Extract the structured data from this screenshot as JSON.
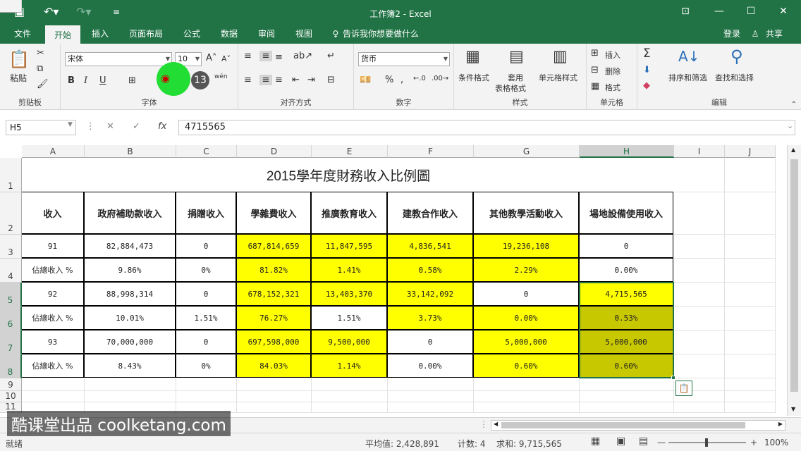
{
  "window": {
    "title": "工作簿2 - Excel"
  },
  "menu_tabs": [
    "文件",
    "开始",
    "插入",
    "页面布局",
    "公式",
    "数据",
    "审阅",
    "视图"
  ],
  "tell_me": "告诉我你想要做什么",
  "account": {
    "login": "登录",
    "share": "共享"
  },
  "ribbon": {
    "clipboard": {
      "label": "剪贴板",
      "paste": "粘贴"
    },
    "font": {
      "label": "字体",
      "name": "宋体",
      "size": "10",
      "bold": "B",
      "italic": "I",
      "underline": "U",
      "phonetic": "wén"
    },
    "alignment": {
      "label": "对齐方式"
    },
    "number": {
      "label": "数字",
      "format": "货币"
    },
    "styles": {
      "label": "样式",
      "cond_format": "条件格式",
      "table_format_1": "套用",
      "table_format_2": "表格格式",
      "cell_styles": "单元格样式"
    },
    "cells": {
      "label": "单元格",
      "insert": "插入",
      "delete": "删除",
      "format": "格式"
    },
    "editing": {
      "label": "编辑",
      "sort_filter": "排序和筛选",
      "find_select": "查找和选择"
    }
  },
  "overlay": {
    "badge": "13"
  },
  "formula_bar": {
    "name_box": "H5",
    "fx": "fx",
    "value": "4715565"
  },
  "columns": [
    "A",
    "B",
    "C",
    "D",
    "E",
    "F",
    "G",
    "H",
    "I",
    "J"
  ],
  "rows": [
    "1",
    "2",
    "3",
    "4",
    "5",
    "6",
    "7",
    "8",
    "9",
    "10",
    "11"
  ],
  "sheet": {
    "title": "2015學年度財務收入比例圖",
    "headers": [
      "收入",
      "政府補助款收入",
      "捐贈收入",
      "學雜費收入",
      "推廣教育收入",
      "建教合作收入",
      "其他教學活動收入",
      "場地設備使用收入"
    ],
    "data_rows": [
      [
        "91",
        "82,884,473",
        "0",
        "687,814,659",
        "11,847,595",
        "4,836,541",
        "19,236,108",
        "0"
      ],
      [
        "佔總收入 %",
        "9.86%",
        "0%",
        "81.82%",
        "1.41%",
        "0.58%",
        "2.29%",
        "0.00%"
      ],
      [
        "92",
        "88,998,314",
        "0",
        "678,152,321",
        "13,403,370",
        "33,142,092",
        "0",
        "4,715,565"
      ],
      [
        "佔總收入 %",
        "10.01%",
        "1.51%",
        "76.27%",
        "1.51%",
        "3.73%",
        "0.00%",
        "0.53%"
      ],
      [
        "93",
        "70,000,000",
        "0",
        "697,598,000",
        "9,500,000",
        "0",
        "5,000,000",
        "5,000,000"
      ],
      [
        "佔總收入 %",
        "8.43%",
        "0%",
        "84.03%",
        "1.14%",
        "0.00%",
        "0.60%",
        "0.60%"
      ]
    ],
    "fill_map": [
      [
        "",
        "",
        "",
        "y",
        "y",
        "y",
        "y",
        ""
      ],
      [
        "",
        "",
        "",
        "y",
        "y",
        "y",
        "y",
        ""
      ],
      [
        "",
        "",
        "",
        "y",
        "y",
        "y",
        "",
        "y"
      ],
      [
        "",
        "",
        "",
        "y",
        "",
        "y",
        "y",
        "o"
      ],
      [
        "",
        "",
        "",
        "y",
        "y",
        "",
        "y",
        "o"
      ],
      [
        "",
        "",
        "",
        "y",
        "y",
        "",
        "y",
        "o"
      ]
    ]
  },
  "colors": {
    "excel_green": "#217346",
    "highlight_yellow": "#ffff00",
    "selected_olive": "#c8c800"
  },
  "status": {
    "ready": "就绪",
    "average": "平均值: 2,428,891",
    "count": "计数: 4",
    "sum": "求和: 9,715,565",
    "zoom": "100%"
  },
  "watermark": "酷课堂出品 coolketang.com"
}
